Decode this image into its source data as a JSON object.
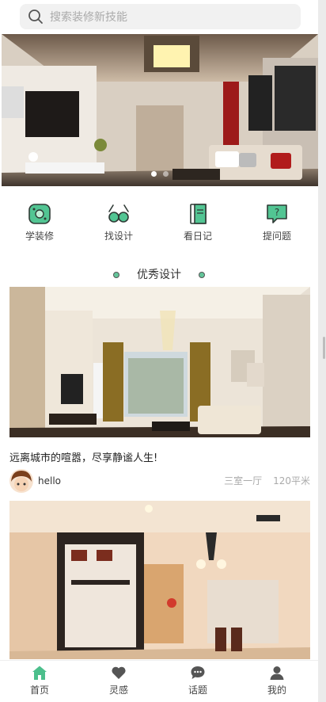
{
  "search": {
    "placeholder": "搜索装修新技能"
  },
  "banner": {
    "slide_count": 2,
    "active_index": 0
  },
  "quick_nav": [
    {
      "label": "学装修",
      "icon": "learn-icon"
    },
    {
      "label": "找设计",
      "icon": "glasses-icon"
    },
    {
      "label": "看日记",
      "icon": "diary-icon"
    },
    {
      "label": "提问题",
      "icon": "question-icon"
    }
  ],
  "section": {
    "title": "优秀设计"
  },
  "cards": [
    {
      "title": "远离城市的喧嚣，尽享静谧人生!",
      "author": "hello",
      "layout": "三室一厅",
      "area": "120平米"
    }
  ],
  "tabbar": [
    {
      "label": "首页",
      "icon": "home-icon",
      "active": true
    },
    {
      "label": "灵感",
      "icon": "heart-icon",
      "active": false
    },
    {
      "label": "话题",
      "icon": "chat-icon",
      "active": false
    },
    {
      "label": "我的",
      "icon": "user-icon",
      "active": false
    }
  ],
  "colors": {
    "accent": "#4cbf8c",
    "text": "#333333",
    "muted": "#aaaaaa"
  }
}
